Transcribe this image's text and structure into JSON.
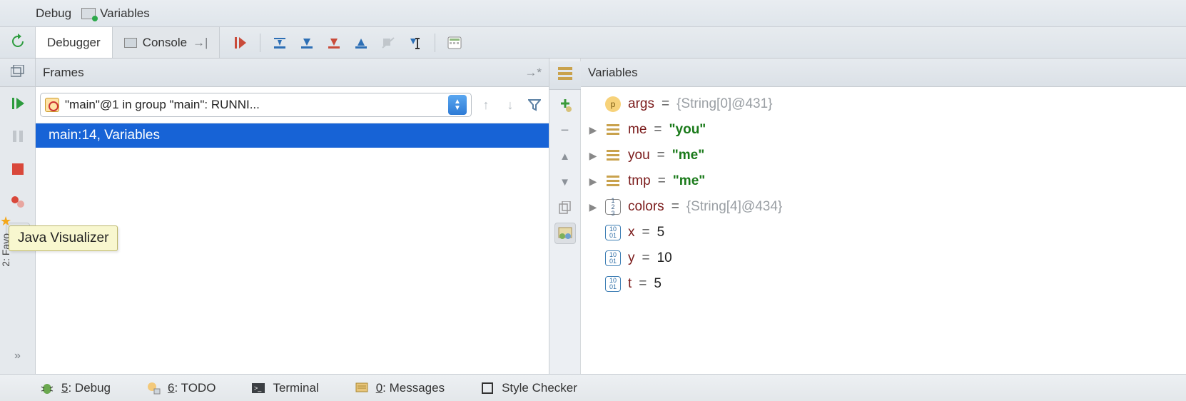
{
  "topStrip": {
    "debug": "Debug",
    "variables": "Variables"
  },
  "tabs": {
    "debugger": "Debugger",
    "console": "Console"
  },
  "framesPanel": {
    "title": "Frames",
    "combo": "\"main\"@1 in group \"main\": RUNNI...",
    "selectedFrame": "main:14, Variables"
  },
  "variablesPanel": {
    "title": "Variables"
  },
  "vars": {
    "args": {
      "name": "args",
      "value": "{String[0]@431}"
    },
    "me": {
      "name": "me",
      "value": "\"you\""
    },
    "you": {
      "name": "you",
      "value": "\"me\""
    },
    "tmp": {
      "name": "tmp",
      "value": "\"me\""
    },
    "colors": {
      "name": "colors",
      "value": "{String[4]@434}"
    },
    "x": {
      "name": "x",
      "value": "5"
    },
    "y": {
      "name": "y",
      "value": "10"
    },
    "t": {
      "name": "t",
      "value": "5"
    }
  },
  "equals": "=",
  "tooltip": "Java Visualizer",
  "status": {
    "debug": {
      "key": "5",
      "label": ": Debug"
    },
    "todo": {
      "key": "6",
      "label": ": TODO"
    },
    "terminal": {
      "label": "Terminal"
    },
    "messages": {
      "key": "0",
      "label": ": Messages"
    },
    "style": {
      "label": "Style Checker"
    }
  },
  "favTab": "2: Favo"
}
